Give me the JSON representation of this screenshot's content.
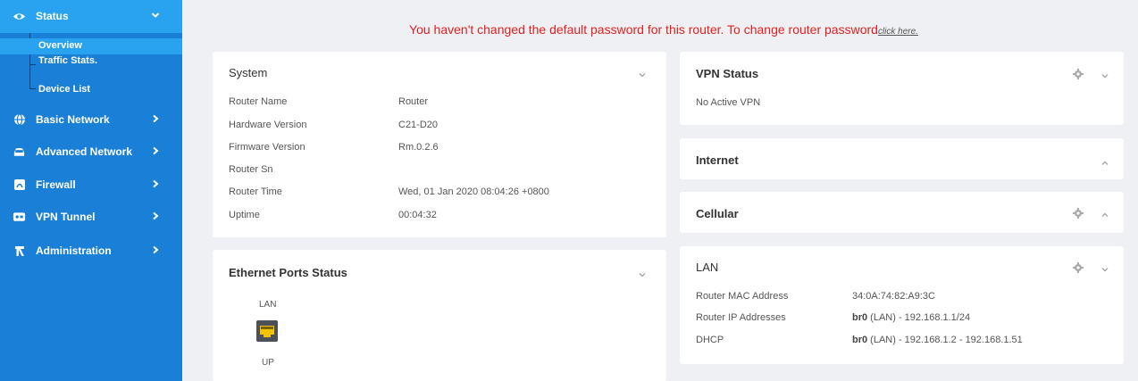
{
  "sidebar": {
    "status": {
      "label": "Status",
      "icon": "eye-icon"
    },
    "sub_items": [
      {
        "label": "Overview",
        "active": true
      },
      {
        "label": "Traffic Stats.",
        "active": false
      },
      {
        "label": "Device List",
        "active": false
      }
    ],
    "items": [
      {
        "label": "Basic Network",
        "icon": "globe-icon"
      },
      {
        "label": "Advanced Network",
        "icon": "car-icon"
      },
      {
        "label": "Firewall",
        "icon": "firewall-icon"
      },
      {
        "label": "VPN Tunnel",
        "icon": "vpn-icon"
      },
      {
        "label": "Administration",
        "icon": "admin-icon"
      }
    ]
  },
  "warning": {
    "text": "You haven't changed the default password for this router. To change router password",
    "link": "click here."
  },
  "system": {
    "title": "System",
    "rows": [
      {
        "key": "Router Name",
        "value": "Router"
      },
      {
        "key": "Hardware Version",
        "value": "C21-D20"
      },
      {
        "key": "Firmware Version",
        "value": "Rm.0.2.6"
      },
      {
        "key": "Router Sn",
        "value": ""
      },
      {
        "key": "Router Time",
        "value": "Wed, 01 Jan 2020 08:04:26 +0800"
      },
      {
        "key": "Uptime",
        "value": "00:04:32"
      }
    ]
  },
  "ethernet": {
    "title": "Ethernet Ports Status",
    "port_label": "LAN",
    "port_state": "UP"
  },
  "vpn": {
    "title": "VPN Status",
    "text": "No Active VPN"
  },
  "internet": {
    "title": "Internet"
  },
  "cellular": {
    "title": "Cellular"
  },
  "lan": {
    "title": "LAN",
    "rows": [
      {
        "key": "Router MAC Address",
        "value": "34:0A:74:82:A9:3C",
        "prefix": ""
      },
      {
        "key": "Router IP Addresses",
        "prefix": "br0",
        "value": " (LAN) - 192.168.1.1/24"
      },
      {
        "key": "DHCP",
        "prefix": "br0",
        "value": " (LAN) - 192.168.1.2 - 192.168.1.51"
      }
    ]
  },
  "colors": {
    "sidebar": "#1a7fd6",
    "sidebar_active": "#29a3f0",
    "warning": "#e02020"
  }
}
